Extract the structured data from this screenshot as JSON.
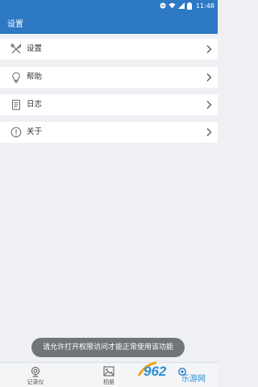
{
  "status_bar": {
    "time": "11:48"
  },
  "app_bar": {
    "title": "设置"
  },
  "menu": {
    "items": [
      {
        "label": "设置",
        "icon": "tools-icon"
      },
      {
        "label": "帮助",
        "icon": "lightbulb-icon"
      },
      {
        "label": "日志",
        "icon": "document-icon"
      },
      {
        "label": "关于",
        "icon": "info-icon"
      }
    ]
  },
  "toast": {
    "message": "请允许打开权限访问才能正常使用该功能"
  },
  "bottom_nav": {
    "items": [
      {
        "label": "记录仪",
        "icon": "camera-recorder-icon"
      },
      {
        "label": "相册",
        "icon": "album-icon"
      },
      {
        "label": "",
        "icon": "settings-icon"
      }
    ]
  },
  "watermark": {
    "text": "962",
    "sub": "乐游网"
  },
  "colors": {
    "primary": "#2e79c4",
    "background": "#eef0f3",
    "toast": "#6b6f73"
  }
}
